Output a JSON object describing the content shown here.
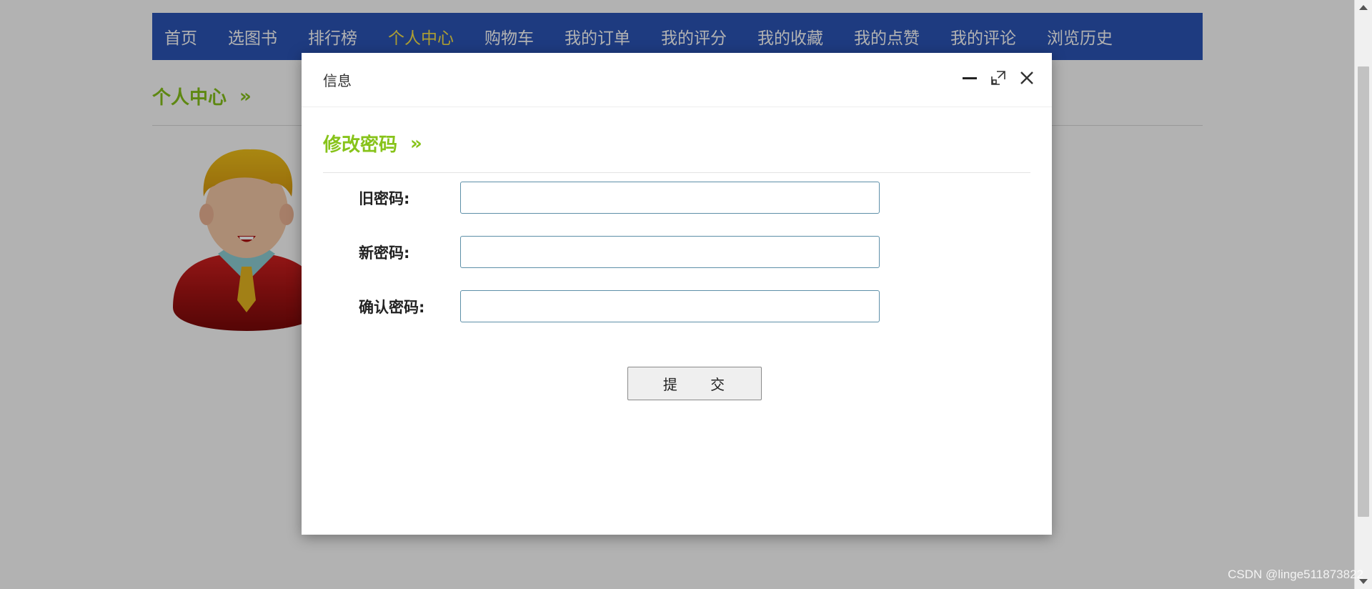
{
  "nav": {
    "items": [
      {
        "label": "首页"
      },
      {
        "label": "选图书"
      },
      {
        "label": "排行榜"
      },
      {
        "label": "个人中心"
      },
      {
        "label": "购物车"
      },
      {
        "label": "我的订单"
      },
      {
        "label": "我的评分"
      },
      {
        "label": "我的收藏"
      },
      {
        "label": "我的点赞"
      },
      {
        "label": "我的评论"
      },
      {
        "label": "浏览历史"
      }
    ],
    "active_index": 3
  },
  "background": {
    "heading": "个人中心",
    "heading_chevron": "»"
  },
  "modal": {
    "title": "信息",
    "section_title": "修改密码",
    "section_chevron": "»",
    "fields": [
      {
        "label": "旧密码:",
        "value": "",
        "placeholder": ""
      },
      {
        "label": "新密码:",
        "value": "",
        "placeholder": ""
      },
      {
        "label": "确认密码:",
        "value": "",
        "placeholder": ""
      }
    ],
    "submit_label": "提 交"
  },
  "colors": {
    "nav_bg": "#2b55b8",
    "nav_active": "#f7e14a",
    "accent_green": "#87c31a"
  },
  "watermark": "CSDN @linge511873822"
}
